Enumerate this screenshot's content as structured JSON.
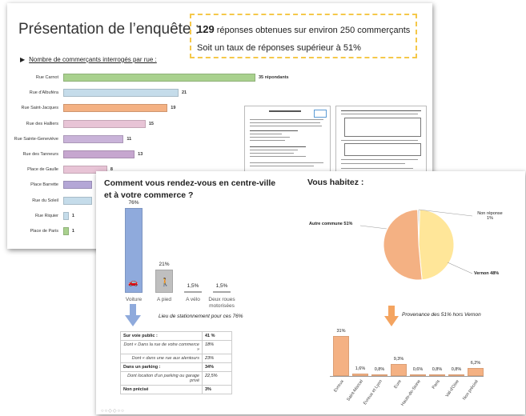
{
  "slide1": {
    "title": "Présentation de l’enquête :",
    "callout": {
      "count": "129",
      "line1_rest": " réponses obtenues sur environ 250 commerçants",
      "line2": "Soit un taux de réponses supérieur à 51%"
    },
    "subheading": "Nombre de commerçants interrogés par rue :"
  },
  "chart_data": [
    {
      "type": "bar",
      "orientation": "horizontal",
      "categories": [
        "Rue Carnot",
        "Rue d'Albuféra",
        "Rue Saint-Jacques",
        "Rue des Halliers",
        "Rue Sainte-Geneviève",
        "Rue des Tanneurs",
        "Place de Gaulle",
        "Place Barrette",
        "Rue du Soleil",
        "Rue Riquier",
        "Place de Paris"
      ],
      "values": [
        35,
        21,
        19,
        15,
        11,
        13,
        8,
        null,
        null,
        1,
        1
      ],
      "value_labels": [
        "35 répondants",
        "21",
        "19",
        "15",
        "11",
        "13",
        "8",
        "",
        "",
        "1",
        "1"
      ],
      "colors": [
        "#a9d18e",
        "#c5dcea",
        "#f4b183",
        "#e8c4d6",
        "#c9b3d9",
        "#c6a6cf",
        "#e8c4d6",
        "#b4a7d6",
        "#c5dcea",
        "#c5dcea",
        "#a9d18e"
      ]
    },
    {
      "type": "bar",
      "title": "Comment vous rendez-vous en centre-ville et à votre commerce ?",
      "categories": [
        "Voiture",
        "A pied",
        "A vélo",
        "Deux roues motorisées"
      ],
      "values": [
        76,
        21,
        1.5,
        1.5
      ],
      "value_labels": [
        "76%",
        "21%",
        "1,5%",
        "1,5%"
      ],
      "colors": [
        "#8faadc",
        "#bfbfbf",
        "#bfbfbf",
        "#bfbfbf"
      ]
    },
    {
      "type": "pie",
      "title": "Vous habitez :",
      "slices": [
        {
          "label": "Autre commune 51%",
          "value": 51,
          "color": "#f4b183"
        },
        {
          "label": "Vernon 48%",
          "value": 48,
          "color": "#ffe699"
        },
        {
          "label": "Non réponse 1%",
          "value": 1,
          "color": "#d9d9d9"
        }
      ]
    },
    {
      "type": "bar",
      "title": "Provenance des 51% hors Vernon",
      "categories": [
        "Evreux",
        "Saint-Marcel",
        "Evreux et Lyon",
        "Eure",
        "Hauts-de-Seine",
        "Paris",
        "Val-d'Oise",
        "Non précisé"
      ],
      "values": [
        31,
        1.6,
        0.8,
        9.3,
        0.8,
        0.8,
        0.8,
        6.2
      ],
      "value_labels": [
        "31%",
        "1,6%",
        "0,8%",
        "9,3%",
        "0,6%",
        "0,8%",
        "0,8%",
        "6,2%"
      ],
      "color": "#f4b183"
    }
  ],
  "slide2": {
    "lieu_caption": "Lieu de stationnement pour ces 76%",
    "parking_table": [
      {
        "label": "Sur voie public :",
        "value": "41 %",
        "kind": "main"
      },
      {
        "label": "Dont « Dans la rue de votre commerce »",
        "value": "18%",
        "kind": "sub"
      },
      {
        "label": "Dont « dans une rue aux alentours",
        "value": "23%",
        "kind": "sub"
      },
      {
        "label": "Dans un parking :",
        "value": "34%",
        "kind": "main"
      },
      {
        "label": "Dont location d’un parking ou garage privé",
        "value": "22,5%",
        "kind": "sub"
      },
      {
        "label": "Non précisé",
        "value": "3%",
        "kind": "main"
      }
    ]
  },
  "icons": {
    "car": "car-icon",
    "walker": "pedestrian-icon"
  },
  "accent_colors": {
    "callout_border": "#f5c84a",
    "arrow": "#f4a460"
  }
}
